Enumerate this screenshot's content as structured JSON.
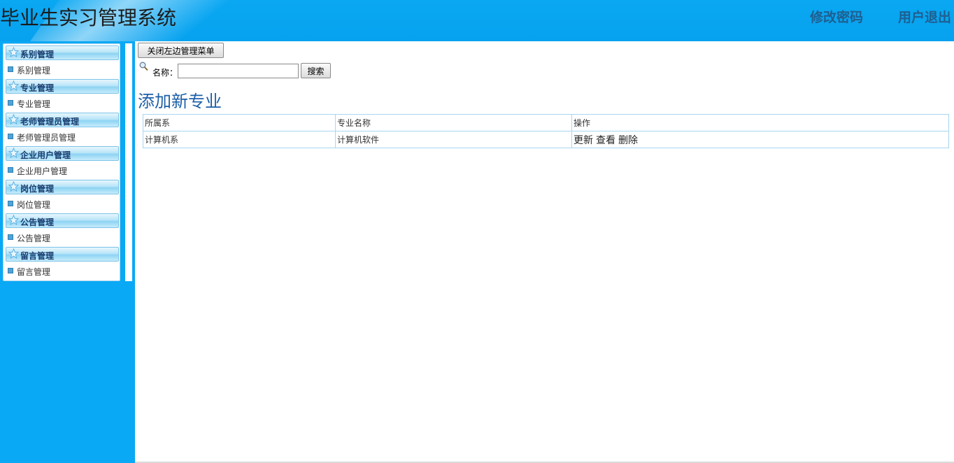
{
  "header": {
    "title": "毕业生实习管理系统",
    "change_password": "修改密码",
    "logout": "用户退出"
  },
  "sidebar": {
    "groups": [
      {
        "title": "系别管理",
        "item": "系别管理"
      },
      {
        "title": "专业管理",
        "item": "专业管理"
      },
      {
        "title": "老师管理员管理",
        "item": "老师管理员管理"
      },
      {
        "title": "企业用户管理",
        "item": "企业用户管理"
      },
      {
        "title": "岗位管理",
        "item": "岗位管理"
      },
      {
        "title": "公告管理",
        "item": "公告管理"
      },
      {
        "title": "留言管理",
        "item": "留言管理"
      }
    ]
  },
  "toolbar": {
    "close_menu_label": "关闭左边管理菜单",
    "search_label": "名称：",
    "search_value": "",
    "search_button": "搜索"
  },
  "main": {
    "add_new_link": "添加新专业",
    "table": {
      "headers": [
        "所属系",
        "专业名称",
        "操作"
      ],
      "rows": [
        {
          "department": "计算机系",
          "major": "计算机软件",
          "actions": [
            "更新",
            "查看",
            "删除"
          ]
        }
      ]
    }
  },
  "colors": {
    "header_bg": "#0aa7f2",
    "sidebar_bg": "#0aa9f5",
    "link_blue": "#1d5fa8",
    "table_border": "#a8d6f0"
  }
}
